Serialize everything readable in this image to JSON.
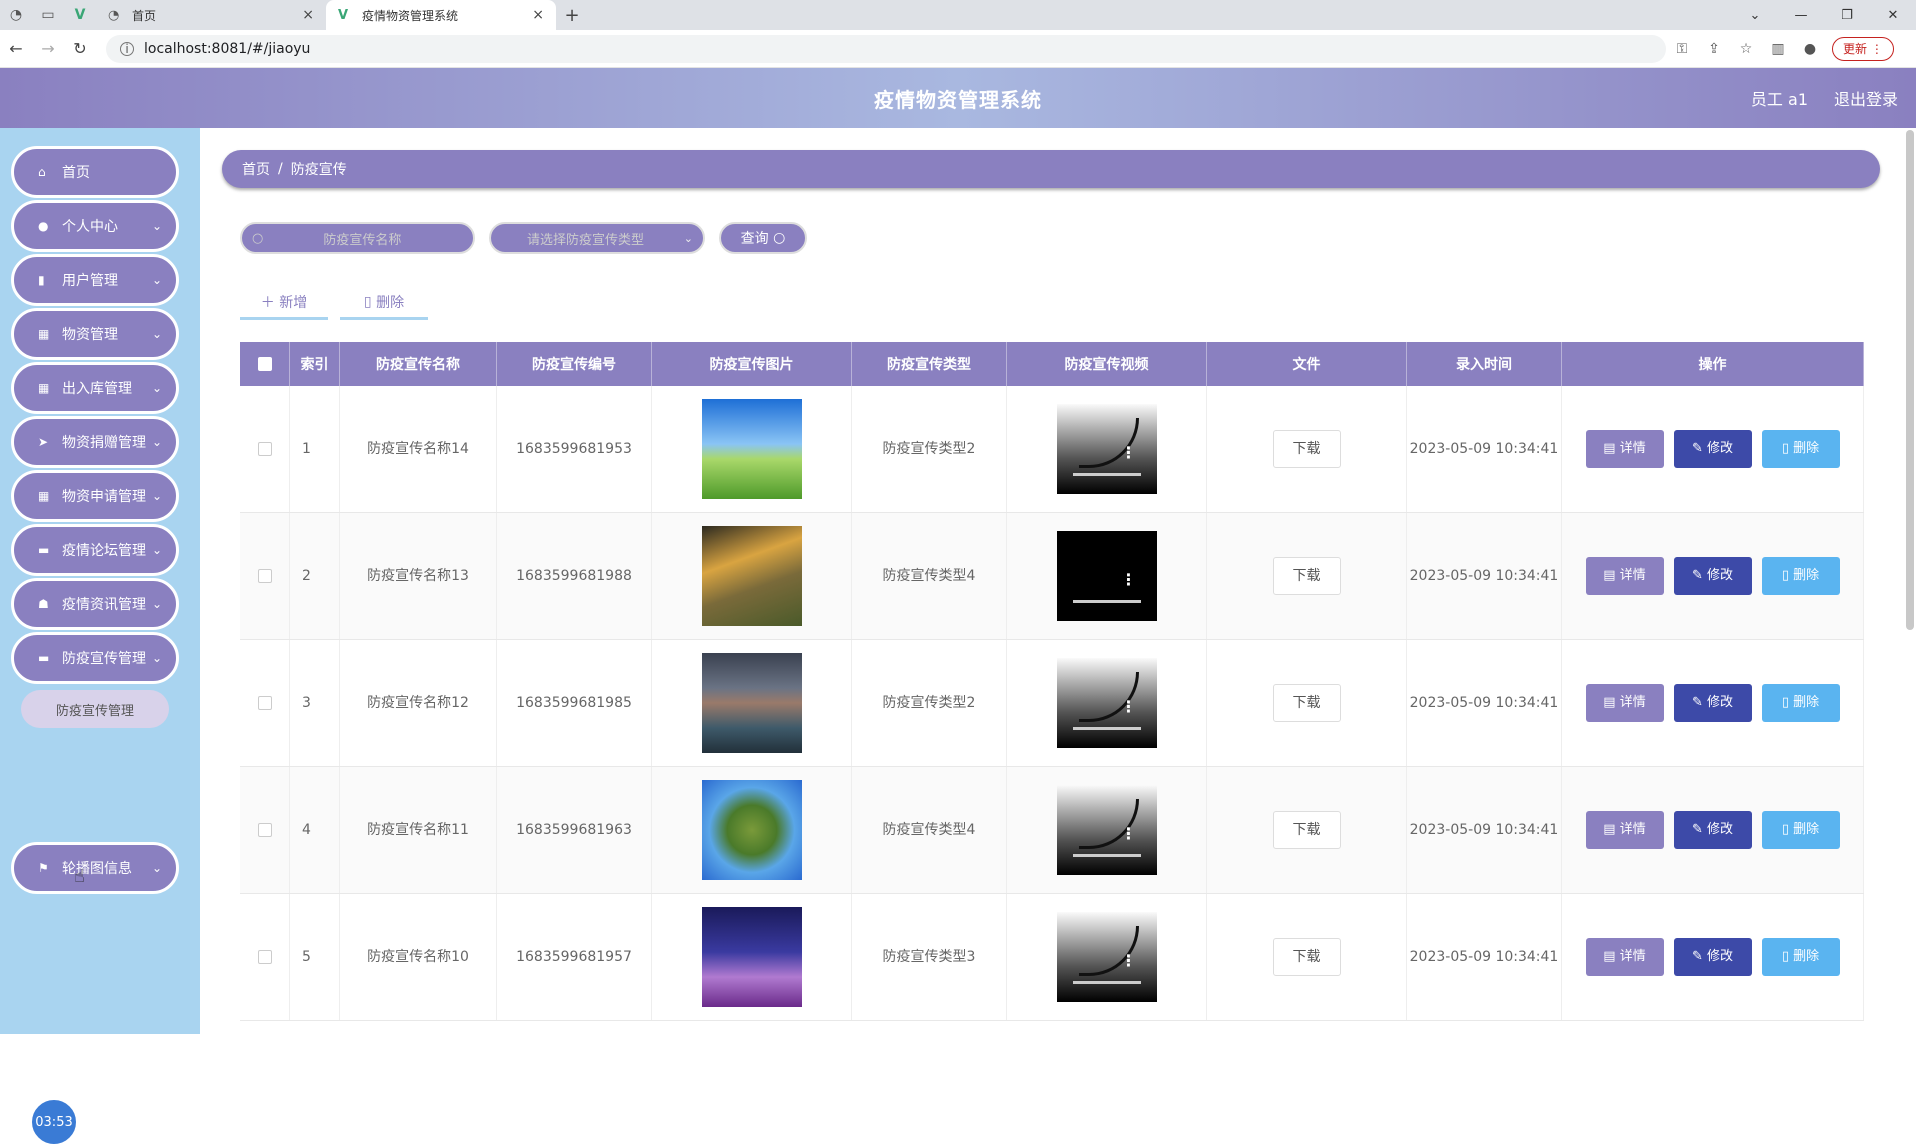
{
  "browser": {
    "tabs": [
      {
        "label": "首页",
        "active": false
      },
      {
        "label": "疫情物资管理系统",
        "active": true
      }
    ],
    "new_tab": "+",
    "url": "localhost:8081/#/jiaoyu",
    "update_label": "更新"
  },
  "header": {
    "title": "疫情物资管理系统",
    "user": "员工 a1",
    "logout": "退出登录"
  },
  "sidebar": {
    "items": [
      {
        "label": "首页",
        "icon": "home-icon",
        "expandable": false
      },
      {
        "label": "个人中心",
        "icon": "user-icon",
        "expandable": true
      },
      {
        "label": "用户管理",
        "icon": "chart-icon",
        "expandable": true
      },
      {
        "label": "物资管理",
        "icon": "grid-icon",
        "expandable": true
      },
      {
        "label": "出入库管理",
        "icon": "grid-icon",
        "expandable": true
      },
      {
        "label": "物资捐赠管理",
        "icon": "send-icon",
        "expandable": true
      },
      {
        "label": "物资申请管理",
        "icon": "grid-icon",
        "expandable": true
      },
      {
        "label": "疫情论坛管理",
        "icon": "chat-icon",
        "expandable": true
      },
      {
        "label": "疫情资讯管理",
        "icon": "thumb-icon",
        "expandable": true
      },
      {
        "label": "防疫宣传管理",
        "icon": "briefcase-icon",
        "expandable": true
      },
      {
        "label": "轮播图信息",
        "icon": "flag-icon",
        "expandable": true
      }
    ],
    "submenu": "防疫宣传管理",
    "clock": "03:53"
  },
  "breadcrumb": {
    "home": "首页",
    "separator": "/",
    "current": "防疫宣传"
  },
  "search": {
    "name_placeholder": "防疫宣传名称",
    "type_placeholder": "请选择防疫宣传类型",
    "query_label": "查询"
  },
  "actions": {
    "add": "新增",
    "delete": "删除"
  },
  "table": {
    "headers": [
      "索引",
      "防疫宣传名称",
      "防疫宣传编号",
      "防疫宣传图片",
      "防疫宣传类型",
      "防疫宣传视频",
      "文件",
      "录入时间",
      "操作"
    ],
    "rows": [
      {
        "index": "1",
        "name": "防疫宣传名称14",
        "no": "1683599681953",
        "type": "防疫宣传类型2",
        "file": "下载",
        "time": "2023-05-09 10:34:41"
      },
      {
        "index": "2",
        "name": "防疫宣传名称13",
        "no": "1683599681988",
        "type": "防疫宣传类型4",
        "file": "下载",
        "time": "2023-05-09 10:34:41"
      },
      {
        "index": "3",
        "name": "防疫宣传名称12",
        "no": "1683599681985",
        "type": "防疫宣传类型2",
        "file": "下载",
        "time": "2023-05-09 10:34:41"
      },
      {
        "index": "4",
        "name": "防疫宣传名称11",
        "no": "1683599681963",
        "type": "防疫宣传类型4",
        "file": "下载",
        "time": "2023-05-09 10:34:41"
      },
      {
        "index": "5",
        "name": "防疫宣传名称10",
        "no": "1683599681957",
        "type": "防疫宣传类型3",
        "file": "下载",
        "time": "2023-05-09 10:34:41"
      }
    ],
    "ops": {
      "detail": "详情",
      "edit": "修改",
      "remove": "删除"
    }
  },
  "colors": {
    "primary": "#8a80c0",
    "sidebar_bg": "#a9d4f0",
    "edit": "#3d4aa8",
    "remove": "#5ab4f0"
  }
}
